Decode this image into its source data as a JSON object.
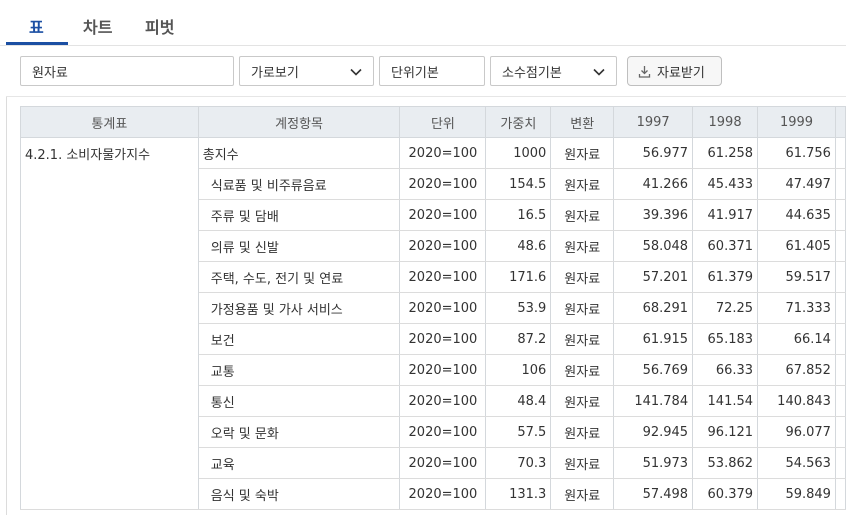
{
  "tabs": [
    {
      "label": "표",
      "active": true
    },
    {
      "label": "차트",
      "active": false
    },
    {
      "label": "피벗",
      "active": false
    }
  ],
  "toolbar": {
    "source_select": "원자료",
    "layout_select": "가로보기",
    "unit_button": "단위기본",
    "decimal_select": "소수점기본",
    "download_button": "자료받기"
  },
  "colors": {
    "accent": "#1b4fa3",
    "header_bg": "#e9edf1"
  },
  "table": {
    "headers": [
      "통계표",
      "계정항목",
      "단위",
      "가중치",
      "변환",
      "1997",
      "1998",
      "1999"
    ],
    "rows": [
      {
        "stat": "4.2.1. 소비자물가지수",
        "item": "총지수",
        "unit": "2020=100",
        "weight": "1000",
        "conv": "원자료",
        "y1997": "56.977",
        "y1998": "61.258",
        "y1999": "61.756"
      },
      {
        "stat": "",
        "item": "식료품 및 비주류음료",
        "unit": "2020=100",
        "weight": "154.5",
        "conv": "원자료",
        "y1997": "41.266",
        "y1998": "45.433",
        "y1999": "47.497"
      },
      {
        "stat": "",
        "item": "주류 및 담배",
        "unit": "2020=100",
        "weight": "16.5",
        "conv": "원자료",
        "y1997": "39.396",
        "y1998": "41.917",
        "y1999": "44.635"
      },
      {
        "stat": "",
        "item": "의류 및 신발",
        "unit": "2020=100",
        "weight": "48.6",
        "conv": "원자료",
        "y1997": "58.048",
        "y1998": "60.371",
        "y1999": "61.405"
      },
      {
        "stat": "",
        "item": "주택, 수도, 전기 및 연료",
        "unit": "2020=100",
        "weight": "171.6",
        "conv": "원자료",
        "y1997": "57.201",
        "y1998": "61.379",
        "y1999": "59.517"
      },
      {
        "stat": "",
        "item": "가정용품 및 가사 서비스",
        "unit": "2020=100",
        "weight": "53.9",
        "conv": "원자료",
        "y1997": "68.291",
        "y1998": "72.25",
        "y1999": "71.333"
      },
      {
        "stat": "",
        "item": "보건",
        "unit": "2020=100",
        "weight": "87.2",
        "conv": "원자료",
        "y1997": "61.915",
        "y1998": "65.183",
        "y1999": "66.14"
      },
      {
        "stat": "",
        "item": "교통",
        "unit": "2020=100",
        "weight": "106",
        "conv": "원자료",
        "y1997": "56.769",
        "y1998": "66.33",
        "y1999": "67.852"
      },
      {
        "stat": "",
        "item": "통신",
        "unit": "2020=100",
        "weight": "48.4",
        "conv": "원자료",
        "y1997": "141.784",
        "y1998": "141.54",
        "y1999": "140.843"
      },
      {
        "stat": "",
        "item": "오락 및 문화",
        "unit": "2020=100",
        "weight": "57.5",
        "conv": "원자료",
        "y1997": "92.945",
        "y1998": "96.121",
        "y1999": "96.077"
      },
      {
        "stat": "",
        "item": "교육",
        "unit": "2020=100",
        "weight": "70.3",
        "conv": "원자료",
        "y1997": "51.973",
        "y1998": "53.862",
        "y1999": "54.563"
      },
      {
        "stat": "",
        "item": "음식 및 숙박",
        "unit": "2020=100",
        "weight": "131.3",
        "conv": "원자료",
        "y1997": "57.498",
        "y1998": "60.379",
        "y1999": "59.849"
      }
    ]
  }
}
